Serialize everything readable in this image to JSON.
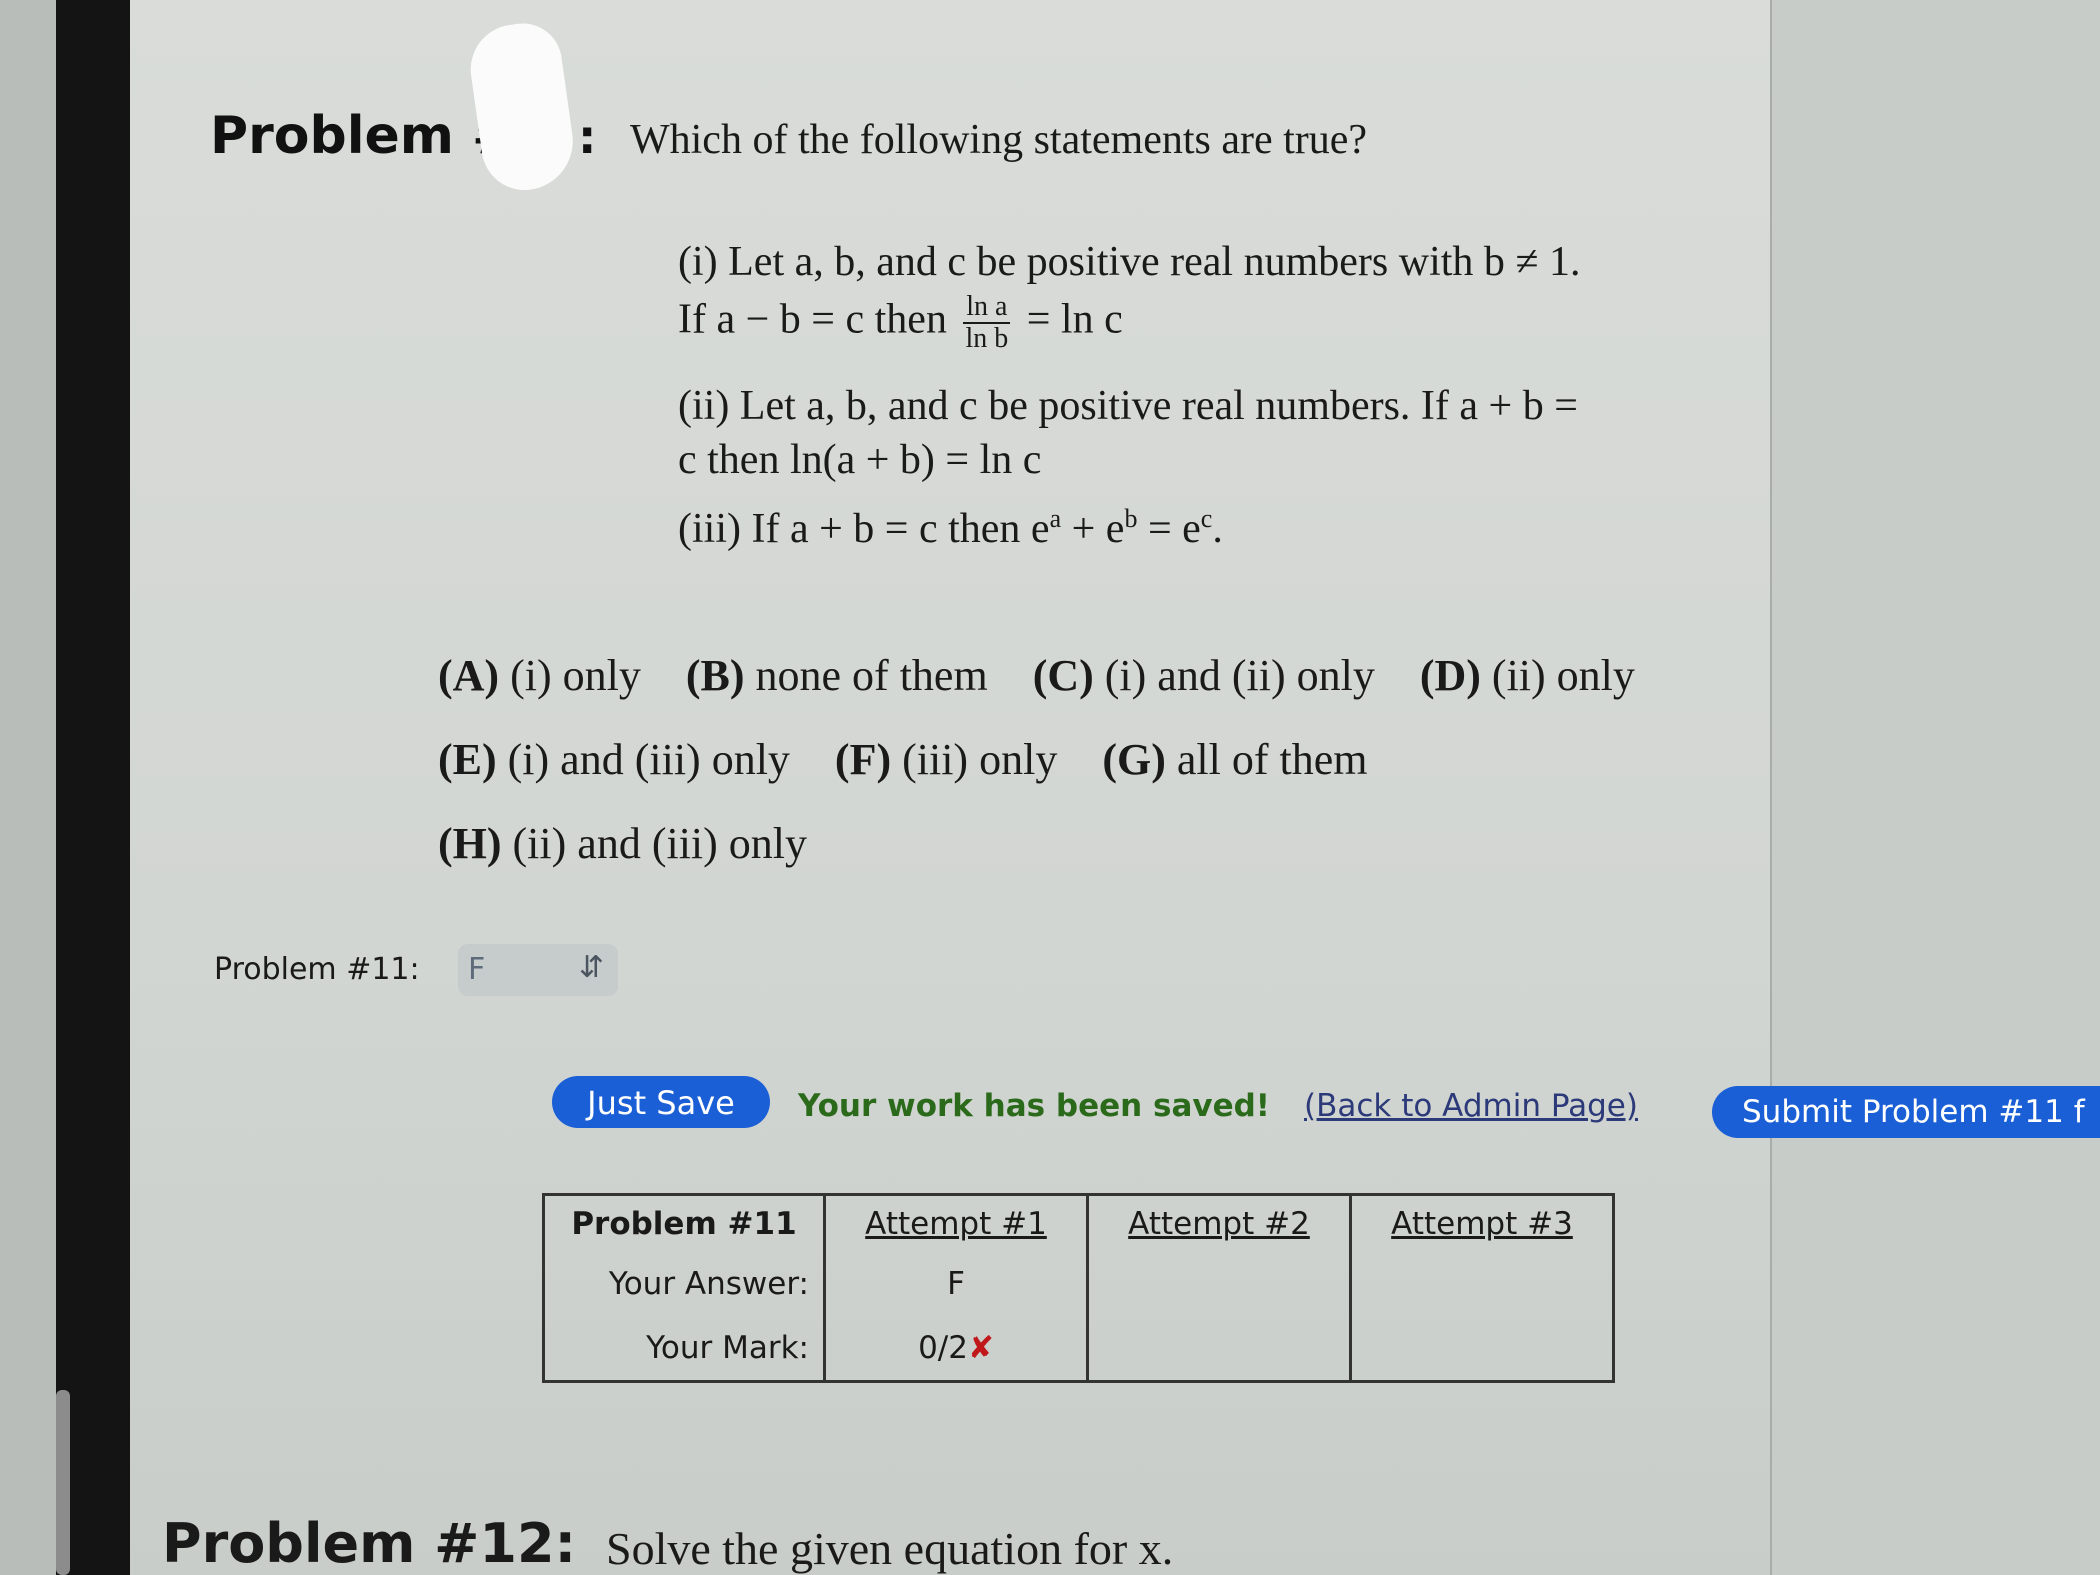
{
  "problem": {
    "heading": "Problem #",
    "heading_colon": ":",
    "question": "Which of the following statements are true?",
    "statements": {
      "s1_line1": "(i) Let a, b, and c be positive real numbers with b ≠ 1.",
      "s1_line2_pre": "If a − b = c then",
      "s1_frac_num": "ln a",
      "s1_frac_den": "ln b",
      "s1_line2_post": "= ln c",
      "s2_line1": "(ii) Let a, b, and c be positive real numbers. If a + b =",
      "s2_line2": "c then ln(a + b) = ln c",
      "s3_pre": "(iii) If a + b = c then e",
      "s3_sup1": "a",
      "s3_mid": " + e",
      "s3_sup2": "b",
      "s3_eq": " = e",
      "s3_sup3": "c",
      "s3_end": "."
    },
    "choices_row1": [
      {
        "letter": "(A)",
        "text": "(i) only"
      },
      {
        "letter": "(B)",
        "text": "none of them"
      },
      {
        "letter": "(C)",
        "text": "(i) and (ii) only"
      },
      {
        "letter": "(D)",
        "text": "(ii) only"
      }
    ],
    "choices_row2": [
      {
        "letter": "(E)",
        "text": "(i) and (iii) only"
      },
      {
        "letter": "(F)",
        "text": "(iii) only"
      },
      {
        "letter": "(G)",
        "text": "all of them"
      }
    ],
    "choices_row3": [
      {
        "letter": "(H)",
        "text": "(ii) and (iii) only"
      }
    ]
  },
  "answer": {
    "label": "Problem #11:",
    "selected": "F",
    "icon": "chevron-updown-icon"
  },
  "actions": {
    "save_label": "Just Save",
    "saved_message": "Your work has been saved!",
    "back_link": "(Back to Admin Page)",
    "submit_label": "Submit Problem #11 f"
  },
  "attempts_table": {
    "title": "Problem #11",
    "headers": [
      "Attempt #1",
      "Attempt #2",
      "Attempt #3"
    ],
    "row_answer_label": "Your Answer:",
    "row_mark_label": "Your Mark:",
    "answers": [
      "F",
      "",
      ""
    ],
    "marks": [
      "0/2",
      "",
      ""
    ],
    "mark_symbol": "✘"
  },
  "next_problem": {
    "heading": "Problem #12:",
    "text": "Solve the given equation for x."
  },
  "colors": {
    "button_blue": "#1a5fd6",
    "saved_green": "#2a6a1a",
    "mark_red": "#c0181a"
  }
}
